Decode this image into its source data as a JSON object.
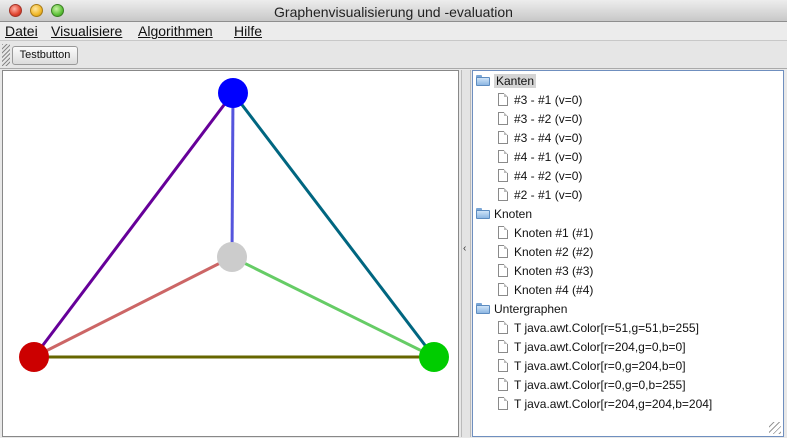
{
  "window": {
    "title": "Graphenvisualisierung und -evaluation"
  },
  "menubar": {
    "items": [
      "Datei",
      "Visualisiere",
      "Algorithmen",
      "Hilfe"
    ]
  },
  "toolbar": {
    "test_button_label": "Testbutton"
  },
  "graph": {
    "nodes": [
      {
        "id": "blue",
        "color": "#0000ff"
      },
      {
        "id": "gray",
        "color": "#cccccc"
      },
      {
        "id": "red",
        "color": "#cc0000"
      },
      {
        "id": "green",
        "color": "#00cc00"
      }
    ],
    "edges": [
      {
        "from": "blue",
        "to": "red",
        "color": "#660099"
      },
      {
        "from": "blue",
        "to": "gray",
        "color": "#5555dd"
      },
      {
        "from": "blue",
        "to": "green",
        "color": "#006680"
      },
      {
        "from": "gray",
        "to": "red",
        "color": "#cc6666"
      },
      {
        "from": "gray",
        "to": "green",
        "color": "#66cc66"
      },
      {
        "from": "red",
        "to": "green",
        "color": "#666600"
      }
    ]
  },
  "tree": {
    "kanten": {
      "label": "Kanten",
      "items": [
        "#3 - #1 (v=0)",
        "#3 - #2 (v=0)",
        "#3 - #4 (v=0)",
        "#4 - #1 (v=0)",
        "#4 - #2 (v=0)",
        "#2 - #1 (v=0)"
      ]
    },
    "knoten": {
      "label": "Knoten",
      "items": [
        "Knoten #1 (#1)",
        "Knoten #2 (#2)",
        "Knoten #3 (#3)",
        "Knoten #4 (#4)"
      ]
    },
    "untergraphen": {
      "label": "Untergraphen",
      "items": [
        "T java.awt.Color[r=51,g=51,b=255]",
        "T java.awt.Color[r=204,g=0,b=0]",
        "T java.awt.Color[r=0,g=204,b=0]",
        "T java.awt.Color[r=0,g=0,b=255]",
        "T java.awt.Color[r=204,g=204,b=204]"
      ]
    }
  },
  "divider": {
    "arrow_glyph": "‹"
  }
}
